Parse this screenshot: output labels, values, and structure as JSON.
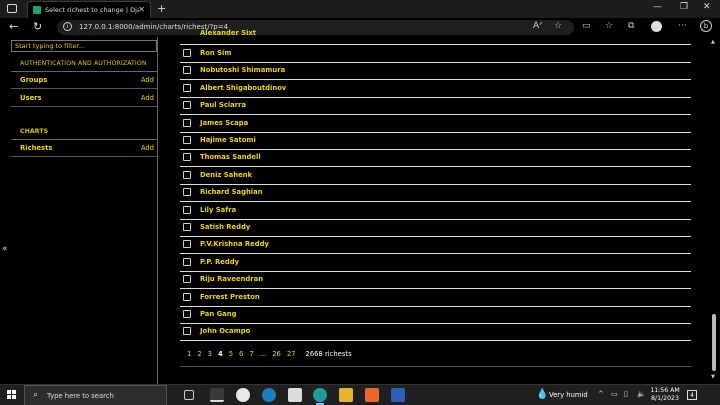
{
  "browser": {
    "tab_title": "Select richest to change | Django",
    "url": "127.0.0.1:8000/admin/charts/richest/?p=4"
  },
  "sidebar": {
    "filter_placeholder": "Start typing to filter...",
    "sections": [
      {
        "title": "AUTHENTICATION AND AUTHORIZATION",
        "items": [
          {
            "label": "Groups",
            "add": "Add"
          },
          {
            "label": "Users",
            "add": "Add"
          }
        ]
      },
      {
        "title": "CHARTS",
        "items": [
          {
            "label": "Richests",
            "add": "Add"
          }
        ]
      }
    ]
  },
  "list": {
    "partial_top": "Alexander Sixt",
    "rows": [
      "Ron Sim",
      "Nobutoshi Shimamura",
      "Albert Shigaboutdinov",
      "Paul Sciarra",
      "James Scapa",
      "Hajime Satomi",
      "Thomas Sandell",
      "Deniz Sahenk",
      "Richard Saghian",
      "Lily Safra",
      "Satish Reddy",
      "P.V.Krishna Reddy",
      "P.P. Reddy",
      "Riju Raveendran",
      "Forrest Preston",
      "Pan Gang",
      "John Ocampo"
    ]
  },
  "pagination": {
    "pages": [
      "1",
      "2",
      "3",
      "4",
      "5",
      "6",
      "7"
    ],
    "current": "4",
    "ellipsis": "...",
    "tail_pages": [
      "26",
      "27"
    ],
    "count": "2668 richests"
  },
  "taskbar": {
    "search_placeholder": "Type here to search",
    "weather": "Very humid",
    "time": "11:56 AM",
    "date": "8/1/2023",
    "notification_count": "4"
  }
}
